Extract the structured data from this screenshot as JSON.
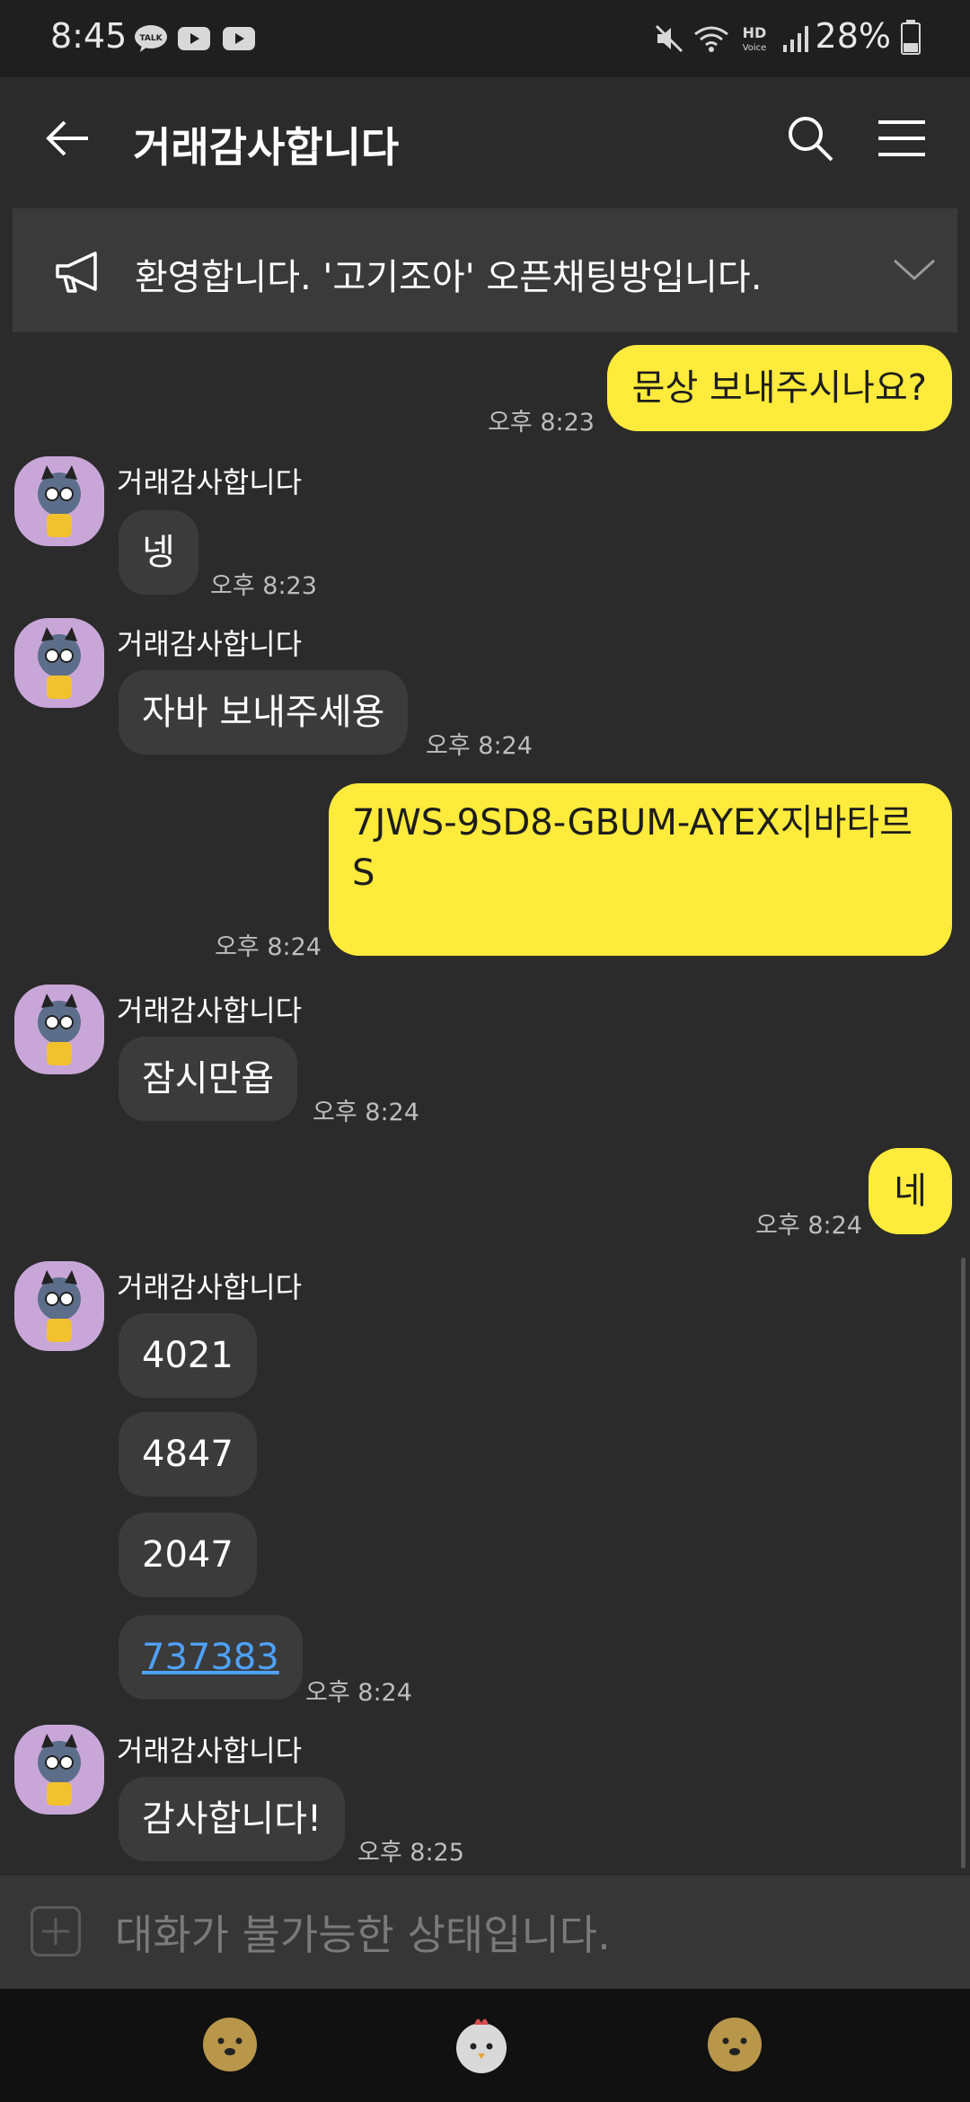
{
  "status": {
    "time": "8:45",
    "battery": "28%"
  },
  "header": {
    "title": "거래감사합니다"
  },
  "notice": {
    "text": "환영합니다. '고기조아' 오픈채팅방입니다."
  },
  "messages": {
    "m1": {
      "text": "문상 보내주시나요?",
      "time": "오후 8:23"
    },
    "m2": {
      "sender": "거래감사합니다",
      "text": "넹",
      "time": "오후 8:23"
    },
    "m3": {
      "sender": "거래감사합니다",
      "text": "자바 보내주세용",
      "time": "오후 8:24"
    },
    "m4": {
      "line1": "7JWS-9SD8-GBUM-AYEX지바타르",
      "line2": "S",
      "time": "오후 8:24"
    },
    "m5": {
      "sender": "거래감사합니다",
      "text": "잠시만욥",
      "time": "오후 8:24"
    },
    "m6": {
      "text": "네",
      "time": "오후 8:24"
    },
    "m7": {
      "sender": "거래감사합니다",
      "lines": [
        "4021",
        "4847",
        "2047"
      ],
      "link": "737383",
      "time": "오후 8:24"
    },
    "m8": {
      "sender": "거래감사합니다",
      "text": "감사합니다!",
      "time": "오후 8:25"
    }
  },
  "input": {
    "placeholder": "대화가 불가능한 상태입니다."
  },
  "colors": {
    "bubble_out": "#ffeb3b",
    "bubble_in": "#3b3b3b",
    "link": "#4ea1ff"
  }
}
